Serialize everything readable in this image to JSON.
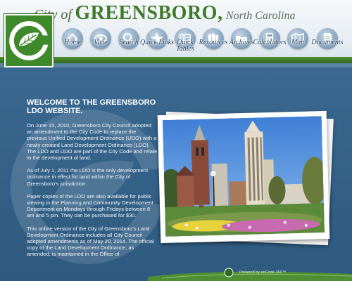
{
  "header": {
    "title_city": "City of",
    "title_main": "GREENSBORO,",
    "title_state": "North Carolina"
  },
  "nav": {
    "items": [
      {
        "label": "Home",
        "icon": "house-icon"
      },
      {
        "label": "View",
        "icon": "eye-icon"
      },
      {
        "label": "Search",
        "icon": "magnifier-icon"
      },
      {
        "label": "Quick Links",
        "icon": "star-icon"
      },
      {
        "label": "Quick Tables",
        "icon": "table-icon"
      },
      {
        "label": "Resources",
        "icon": "books-icon"
      },
      {
        "label": "Archives",
        "icon": "folder-icon"
      },
      {
        "label": "Calculators",
        "icon": "calculator-icon"
      },
      {
        "label": "Map",
        "icon": "map-icon"
      },
      {
        "label": "Documents",
        "icon": "document-icon"
      }
    ]
  },
  "intro": {
    "heading": "WELCOME TO THE GREENSBORO LDO WEBSITE.",
    "paragraphs": [
      "On June 15, 2010, Greensboro City Council adopted an amendment to the City Code to replace the previous Unified Development Ordinance (UDO) with a newly created Land Development Ordinance (LDO). The LDO and UDO are part of the City Code and relate to the development of land.",
      "As of July 1, 2011 the LDO is the only development ordinance in effect for land within the City of Greensboro's jurisdiction.",
      "Paper copies of the LDO are also available for public viewing in the Planning and Community Development Department on Mondays through Fridays between 8 am and 5 pm. They can be purchased for $30.",
      "This online version of the City of Greensboro's Land Development Ordinance includes all City Council adopted amendments as of May 20, 2014. The official copy of the Land Development Ordinance, as amended, is maintained in the Office of"
    ]
  },
  "footer": {
    "powered_by": "Powered by enCode-360™",
    "logo_text": "360"
  },
  "colors": {
    "brand_green": "#3e8a2a",
    "page_blue": "#3a6890",
    "nav_text": "#1d3e5c"
  }
}
